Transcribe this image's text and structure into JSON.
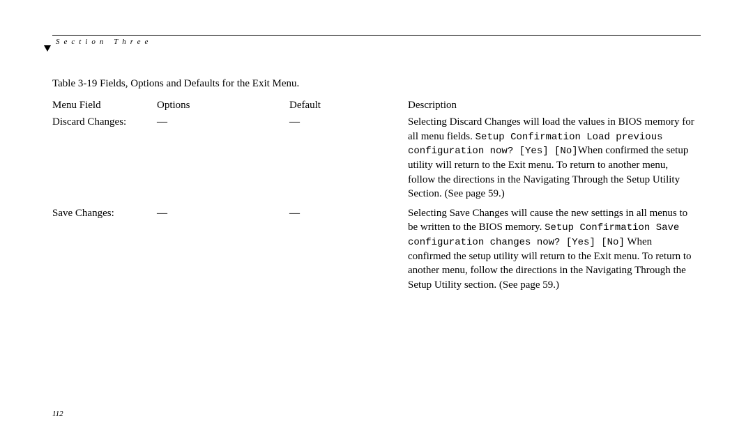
{
  "header": {
    "section_label": "Section Three"
  },
  "caption": "Table 3-19 Fields, Options and Defaults for the Exit Menu.",
  "columns": {
    "field": "Menu Field",
    "options": "Options",
    "default": "Default",
    "description": "Description"
  },
  "rows": [
    {
      "field": "Discard Changes:",
      "options": "—",
      "default": "—",
      "desc_pre": "Selecting Discard Changes will load the values in BIOS memory for all menu fields. ",
      "desc_mono": "Setup Confirmation Load previous configuration now? [Yes] [No]",
      "desc_post": "When confirmed the setup utility will return to the Exit menu. To return to another menu, follow the directions in the Navigating Through the Setup Utility Section. (See page 59.)"
    },
    {
      "field": "Save Changes:",
      "options": "—",
      "default": "—",
      "desc_pre": "Selecting Save Changes will cause the new settings in all menus to be written to the BIOS memory. ",
      "desc_mono": "Setup Confirmation Save configuration changes now? [Yes] [No]",
      "desc_post": " When confirmed the setup utility will return to the Exit menu. To return to another menu, follow the directions in the Navigating Through the Setup Utility section. (See page 59.)"
    }
  ],
  "page_number": "112"
}
